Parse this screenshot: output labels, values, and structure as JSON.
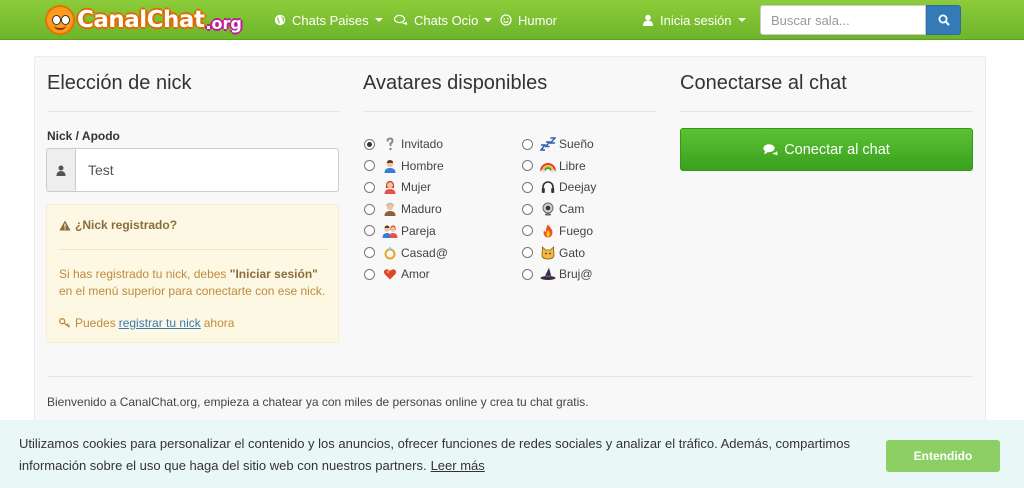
{
  "logo": {
    "name": "CanalChat",
    "tld": ".org"
  },
  "nav": {
    "chats_paises": "Chats Paises",
    "chats_ocio": "Chats Ocio",
    "humor": "Humor",
    "login": "Inicia sesión"
  },
  "search": {
    "placeholder": "Buscar sala..."
  },
  "nick": {
    "title": "Elección de nick",
    "label": "Nick / Apodo",
    "value": "Test"
  },
  "alert": {
    "title": "¿Nick registrado?",
    "text_before": "Si has registrado tu nick, debes ",
    "text_bold": "\"Iniciar sesión\"",
    "text_after": " en el menú superior para conectarte con ese nick.",
    "link_prefix": "Puedes",
    "link_text": "registrar tu nick",
    "link_suffix": "ahora"
  },
  "avatars": {
    "title": "Avatares disponibles",
    "left": [
      {
        "label": "Invitado",
        "icon": "question-icon",
        "checked": true
      },
      {
        "label": "Hombre",
        "icon": "man-icon",
        "checked": false
      },
      {
        "label": "Mujer",
        "icon": "woman-icon",
        "checked": false
      },
      {
        "label": "Maduro",
        "icon": "old-man-icon",
        "checked": false
      },
      {
        "label": "Pareja",
        "icon": "couple-icon",
        "checked": false
      },
      {
        "label": "Casad@",
        "icon": "ring-icon",
        "checked": false
      },
      {
        "label": "Amor",
        "icon": "heart-icon",
        "checked": false
      }
    ],
    "right": [
      {
        "label": "Sueño",
        "icon": "zzz-icon",
        "checked": false
      },
      {
        "label": "Libre",
        "icon": "rainbow-icon",
        "checked": false
      },
      {
        "label": "Deejay",
        "icon": "headphones-icon",
        "checked": false
      },
      {
        "label": "Cam",
        "icon": "webcam-icon",
        "checked": false
      },
      {
        "label": "Fuego",
        "icon": "fire-icon",
        "checked": false
      },
      {
        "label": "Gato",
        "icon": "cat-icon",
        "checked": false
      },
      {
        "label": "Bruj@",
        "icon": "witch-hat-icon",
        "checked": false
      }
    ]
  },
  "connect": {
    "title": "Conectarse al chat",
    "button": "Conectar al chat"
  },
  "welcome": "Bienvenido a CanalChat.org, empieza a chatear ya con miles de personas online y crea tu chat gratis.",
  "cookies": {
    "text": "Utilizamos cookies para personalizar el contenido y los anuncios, ofrecer funciones de redes sociales y analizar el tráfico. Además, compartimos información sobre el uso que haga del sitio web con nuestros partners.",
    "link": "Leer más",
    "button": "Entendido"
  },
  "colors": {
    "nav_green": "#7cc232",
    "button_green": "#4cb028",
    "search_blue": "#337ab7",
    "alert_bg": "#fcf8e3",
    "cookie_bg": "#eaf7f7"
  }
}
